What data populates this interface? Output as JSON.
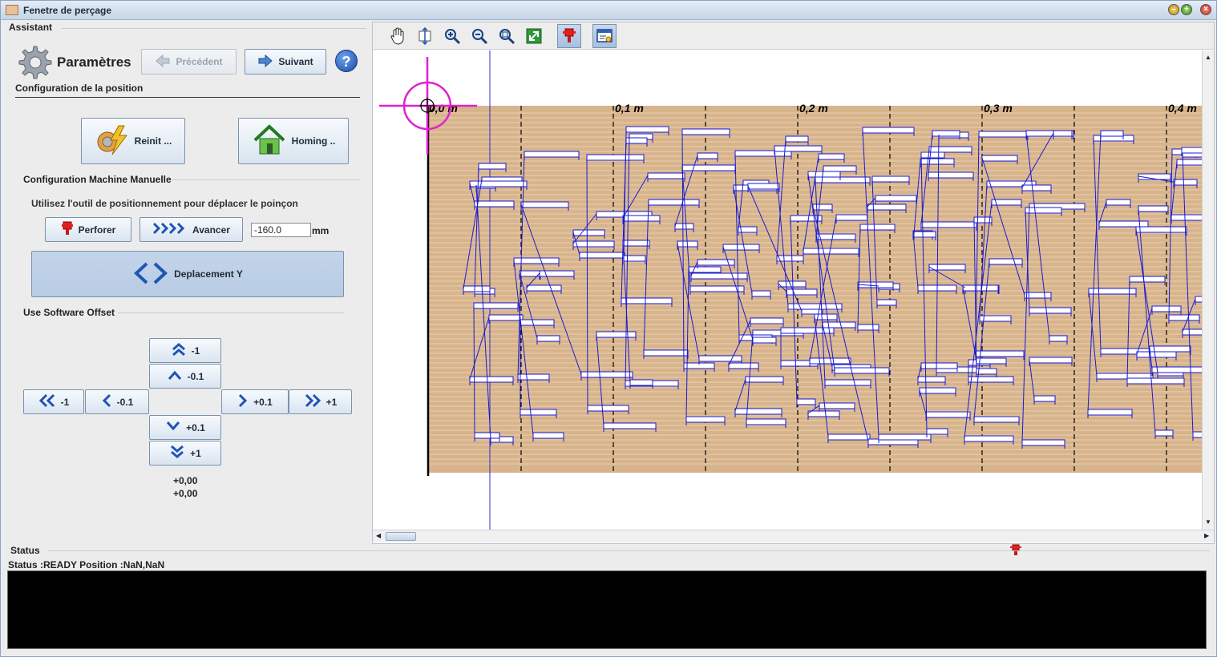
{
  "window": {
    "title": "Fenetre de perçage"
  },
  "assistant": {
    "legend": "Assistant",
    "heading": "Paramètres",
    "prev_label": "Précédent",
    "next_label": "Suivant",
    "subtitle": "Configuration de la position"
  },
  "position": {
    "reinit_label": "Reinit ...",
    "homing_label": "Homing .."
  },
  "manual": {
    "legend": "Configuration Machine Manuelle",
    "hint": "Utilisez l'outil de positionnement pour déplacer le poinçon",
    "perforer_label": "Perforer",
    "avancer_label": "Avancer",
    "distance_value": "-160.0",
    "unit": "mm",
    "move_label": "Deplacement Y"
  },
  "offset": {
    "legend": "Use Software Offset",
    "up1": "-1",
    "up01": "-0.1",
    "left1": "-1",
    "left01": "-0.1",
    "right01": "+0.1",
    "right1": "+1",
    "down01": "+0.1",
    "down1": "+1",
    "value_x": "+0,00",
    "value_y": "+0,00"
  },
  "canvas": {
    "ruler_labels": [
      "0,0 m",
      "0,1 m",
      "0,2 m",
      "0,3 m",
      "0,4 m"
    ],
    "toolbar": [
      "hand-tool-icon",
      "fit-height-icon",
      "zoom-in-icon",
      "zoom-out-icon",
      "zoom-window-icon",
      "fit-all-icon",
      "punch-icon",
      "display-options-icon"
    ]
  },
  "status": {
    "legend": "Status",
    "text": "Status :READY Position :NaN,NaN"
  },
  "colors": {
    "board": "#d8b48c",
    "notes": "#1a1ad0",
    "cursor": "#e020d0"
  }
}
